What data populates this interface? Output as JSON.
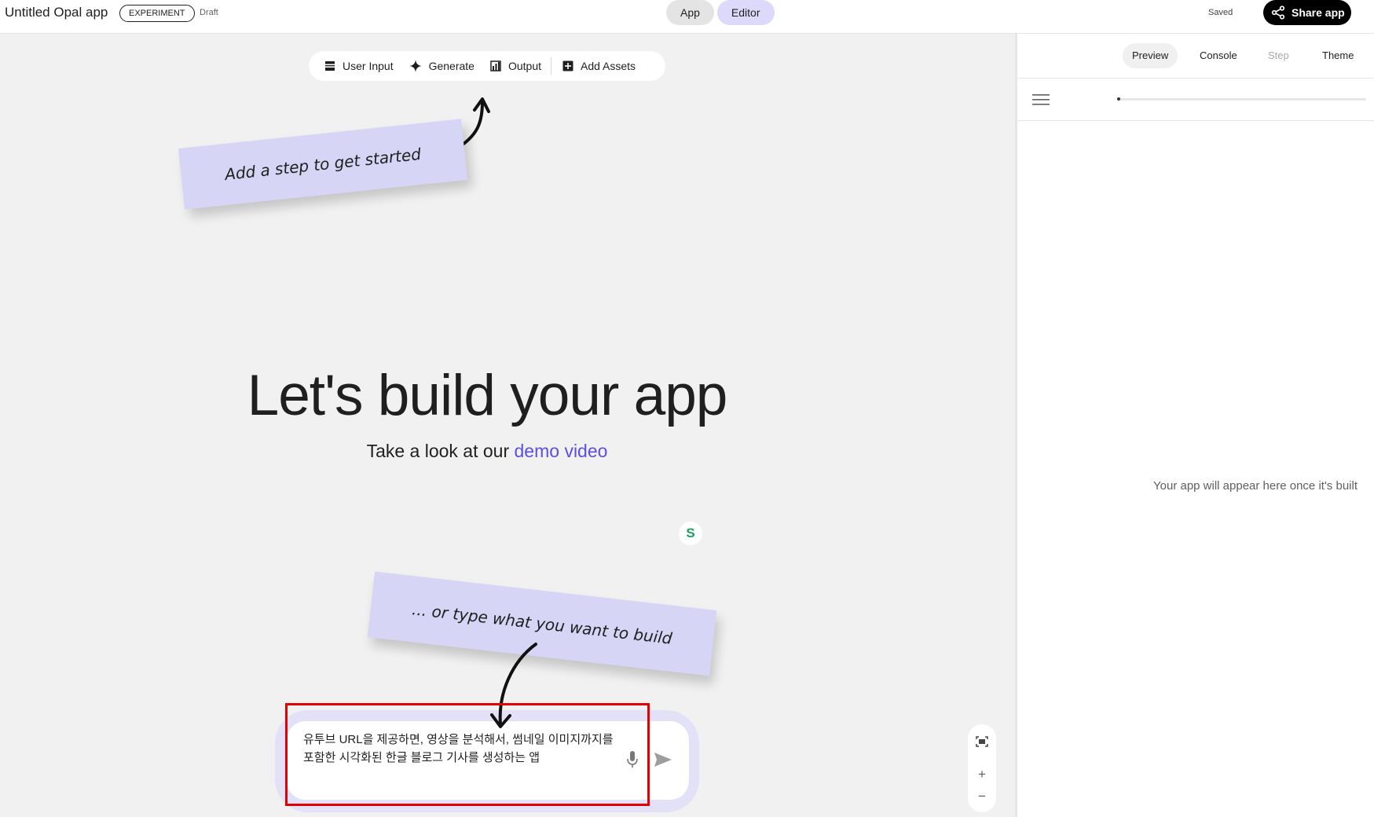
{
  "header": {
    "app_title": "Untitled Opal app",
    "badge": "EXPERIMENT",
    "status": "Draft",
    "modes": [
      {
        "label": "App"
      },
      {
        "label": "Editor"
      }
    ],
    "active_mode": "Editor",
    "saved_label": "Saved",
    "share_label": "Share app"
  },
  "toolbar": {
    "items": [
      {
        "label": "User Input",
        "icon": "user-input-icon"
      },
      {
        "label": "Generate",
        "icon": "sparkle-icon"
      },
      {
        "label": "Output",
        "icon": "output-icon"
      },
      {
        "label": "Add Assets",
        "icon": "add-box-icon"
      }
    ]
  },
  "notes": {
    "step_hint": "Add a step to get started",
    "type_hint": "... or type what you want to build"
  },
  "hero": {
    "title": "Let's build your app",
    "subtitle_prefix": "Take a look at our ",
    "subtitle_link": "demo video"
  },
  "prompt": {
    "value": "유투브 URL을 제공하면, 영상을 분석해서, 썸네일 이미지까지를 포함한 시각화된 한글 블로그 기사를 생성하는 앱"
  },
  "zoom": {
    "fit": "fit-icon",
    "in": "+",
    "out": "−"
  },
  "right_panel": {
    "tabs": [
      {
        "label": "Preview",
        "state": "active"
      },
      {
        "label": "Console",
        "state": "normal"
      },
      {
        "label": "Step",
        "state": "disabled"
      },
      {
        "label": "Theme",
        "state": "normal"
      }
    ],
    "empty_message": "Your app will appear here once it's built"
  },
  "colors": {
    "accent": "#5a4fe3",
    "note_bg": "#d6d5f5",
    "highlight": "#e40000"
  }
}
